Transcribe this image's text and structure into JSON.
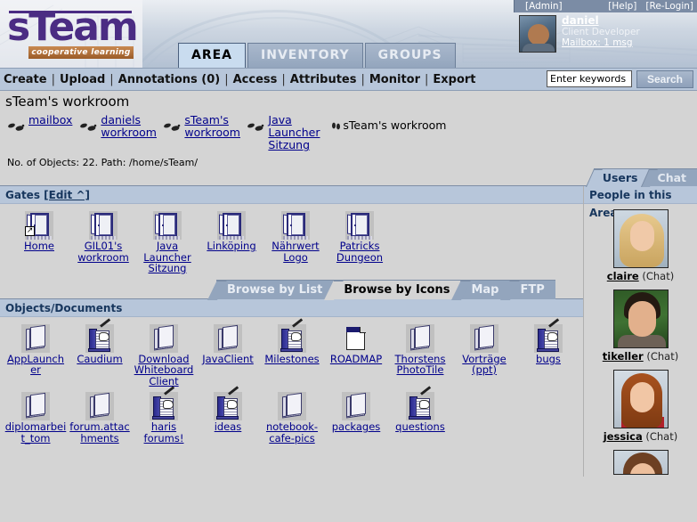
{
  "brand": {
    "logo_text": "sTeam",
    "logo_tagline": "cooperative learning",
    "accent_purple": "#4b2c83",
    "accent_orange": "#9b5b27"
  },
  "user_panel": {
    "admin_link": "[Admin]",
    "help_link": "[Help]",
    "relogin_link": "[Re-Login]",
    "username": "daniel",
    "role": "Client Developer",
    "mailbox": "Mailbox: 1 msg"
  },
  "top_tabs": [
    {
      "label": "AREA",
      "active": true
    },
    {
      "label": "INVENTORY",
      "active": false
    },
    {
      "label": "GROUPS",
      "active": false
    }
  ],
  "nav": {
    "items": [
      "Create",
      "Upload",
      "Annotations (0)",
      "Access",
      "Attributes",
      "Monitor",
      "Export"
    ],
    "separator": "|"
  },
  "search": {
    "value": "Enter keywords",
    "placeholder": "Enter keywords",
    "button_label": "Search"
  },
  "page": {
    "title": "sTeam's workroom",
    "path_info": "No. of Objects: 22. Path: /home/sTeam/"
  },
  "breadcrumbs": [
    {
      "label": "mailbox",
      "icon": "footprints-icon",
      "current": false
    },
    {
      "label": "daniels workroom",
      "icon": "footprints-icon",
      "current": false
    },
    {
      "label": "sTeam's workroom",
      "icon": "footprints-icon",
      "current": false
    },
    {
      "label": "Java Launcher Sitzung",
      "icon": "footprints-icon",
      "current": false
    },
    {
      "label": "sTeam's workroom",
      "icon": "footprints-icon",
      "current": true
    }
  ],
  "user_tabs": [
    {
      "label": "Users",
      "active": true
    },
    {
      "label": "Chat",
      "active": false
    }
  ],
  "gates": {
    "header_label": "Gates",
    "edit_label": "[Edit ^]",
    "items": [
      {
        "label": "Home",
        "icon": "door-icon",
        "badge": "↗"
      },
      {
        "label": "GIL01's workroom",
        "icon": "door-icon",
        "badge": ""
      },
      {
        "label": "Java Launcher Sitzung",
        "icon": "door-icon",
        "badge": ""
      },
      {
        "label": "Linköping",
        "icon": "door-icon",
        "badge": ""
      },
      {
        "label": "Nährwert Logo",
        "icon": "door-icon",
        "badge": ""
      },
      {
        "label": "Patricks Dungeon",
        "icon": "door-icon",
        "badge": ""
      }
    ]
  },
  "browse_tabs": [
    {
      "label": "Browse by List",
      "active": false
    },
    {
      "label": "Browse by Icons",
      "active": true
    },
    {
      "label": "Map",
      "active": false
    },
    {
      "label": "FTP",
      "active": false
    }
  ],
  "objects": {
    "header_label": "Objects/Documents",
    "items": [
      {
        "label": "AppLauncher",
        "icon": "book-icon"
      },
      {
        "label": "Caudium",
        "icon": "notebook-pen-icon"
      },
      {
        "label": "Download Whiteboard Client",
        "icon": "book-icon"
      },
      {
        "label": "JavaClient",
        "icon": "book-icon"
      },
      {
        "label": "Milestones",
        "icon": "notebook-pen-icon"
      },
      {
        "label": "ROADMAP",
        "icon": "document-icon"
      },
      {
        "label": "Thorstens PhotoTile",
        "icon": "book-icon"
      },
      {
        "label": "Vorträge (ppt)",
        "icon": "book-icon"
      },
      {
        "label": "bugs",
        "icon": "notebook-pen-icon"
      },
      {
        "label": "diplomarbeit_tom",
        "icon": "book-icon"
      },
      {
        "label": "forum.attachments",
        "icon": "book-icon"
      },
      {
        "label": "haris forums!",
        "icon": "notebook-pen-icon"
      },
      {
        "label": "ideas",
        "icon": "notebook-pen-icon"
      },
      {
        "label": "notebook-cafe-pics",
        "icon": "book-icon"
      },
      {
        "label": "packages",
        "icon": "book-icon"
      },
      {
        "label": "questions",
        "icon": "notebook-pen-icon"
      }
    ]
  },
  "people": {
    "header_label": "People in this Area",
    "items": [
      {
        "name": "claire",
        "action": "(Chat)",
        "photo": "claire"
      },
      {
        "name": "tikeller",
        "action": "(Chat)",
        "photo": "tikeller"
      },
      {
        "name": "jessica",
        "action": "(Chat)",
        "photo": "jessica"
      },
      {
        "name": "",
        "action": "",
        "photo": "fourth"
      }
    ]
  }
}
